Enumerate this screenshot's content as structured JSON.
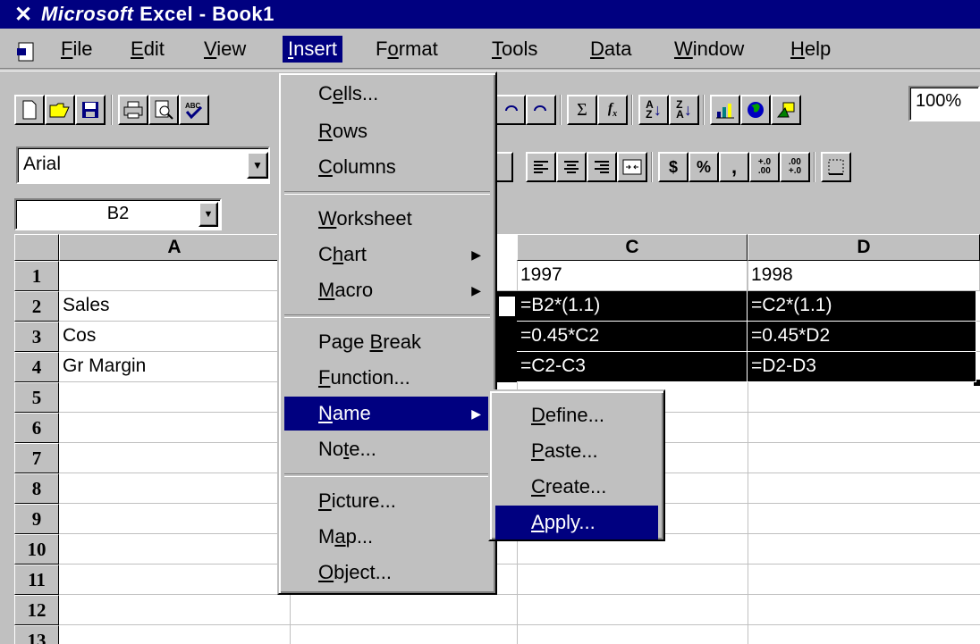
{
  "window": {
    "app_name": "Microsoft",
    "title": "Excel - Book1"
  },
  "menubar": {
    "items": [
      {
        "label": "File"
      },
      {
        "label": "Edit"
      },
      {
        "label": "View"
      },
      {
        "label": "Insert"
      },
      {
        "label": "Format"
      },
      {
        "label": "Tools"
      },
      {
        "label": "Data"
      },
      {
        "label": "Window"
      },
      {
        "label": "Help"
      }
    ],
    "active": "Insert"
  },
  "toolbar": {
    "zoom": "100%"
  },
  "formatting": {
    "font": "Arial"
  },
  "namebox": {
    "value": "B2"
  },
  "grid": {
    "columns": [
      "A",
      "C",
      "D"
    ],
    "rows": [
      "1",
      "2",
      "3",
      "4",
      "5",
      "6",
      "7",
      "8",
      "9",
      "10",
      "11",
      "12",
      "13"
    ],
    "cells": {
      "A2": "Sales",
      "A3": "Cos",
      "A4": "Gr Margin",
      "C1": "1997",
      "D1": "1998",
      "C2": "=B2*(1.1)",
      "D2": "=C2*(1.1)",
      "C3": "=0.45*C2",
      "D3": "=0.45*D2",
      "C4": "=C2-C3",
      "D4": "=D2-D3"
    }
  },
  "insert_menu": {
    "items": [
      {
        "label": "Cells..."
      },
      {
        "label": "Rows"
      },
      {
        "label": "Columns"
      },
      {
        "label": "Worksheet"
      },
      {
        "label": "Chart"
      },
      {
        "label": "Macro"
      },
      {
        "label": "Page Break"
      },
      {
        "label": "Function..."
      },
      {
        "label": "Name"
      },
      {
        "label": "Note..."
      },
      {
        "label": "Picture..."
      },
      {
        "label": "Map..."
      },
      {
        "label": "Object..."
      }
    ],
    "highlighted": "Name"
  },
  "name_submenu": {
    "items": [
      {
        "label": "Define..."
      },
      {
        "label": "Paste..."
      },
      {
        "label": "Create..."
      },
      {
        "label": "Apply..."
      }
    ],
    "highlighted": "Apply..."
  },
  "colors": {
    "highlight": "#000080",
    "face": "#c0c0c0"
  }
}
